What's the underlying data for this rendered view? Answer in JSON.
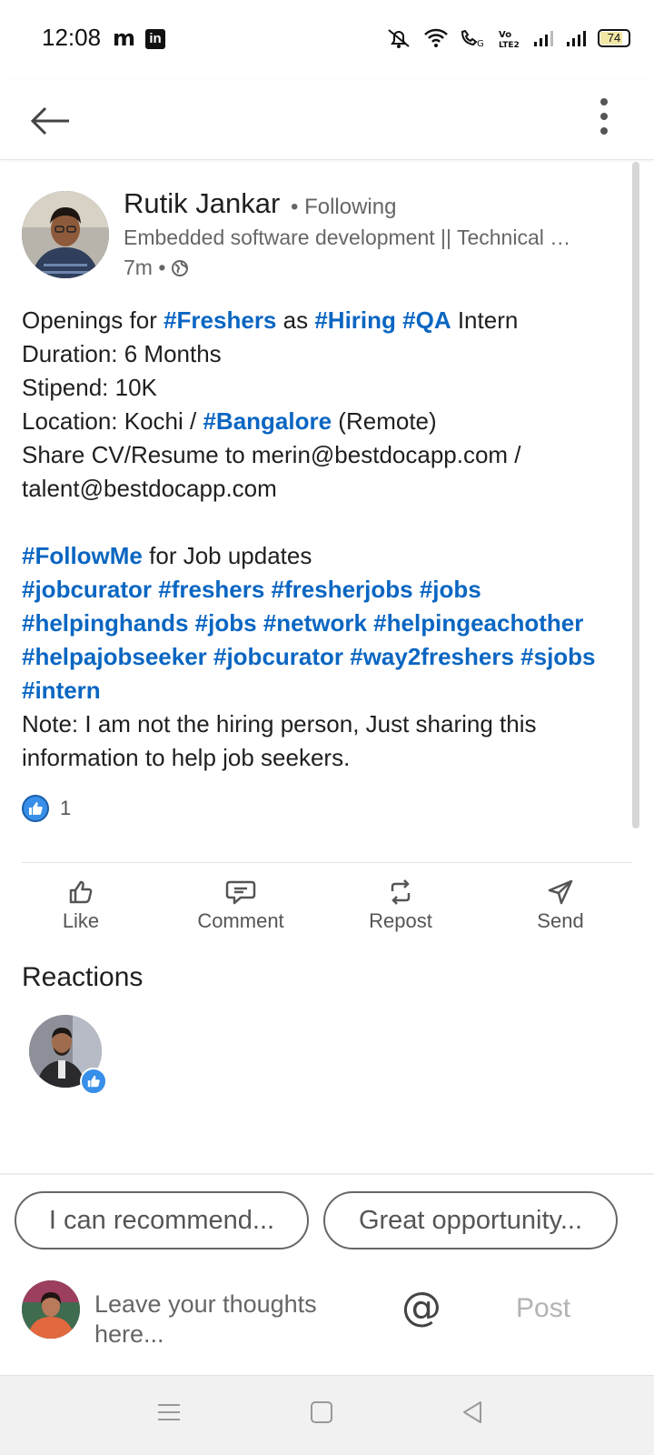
{
  "status_bar": {
    "time": "12:08",
    "app_icons": [
      "m",
      "in"
    ],
    "battery": "74"
  },
  "post": {
    "author": {
      "name": "Rutik Jankar",
      "follow_status": "• Following",
      "headline": "Embedded software development || Technical …",
      "time_ago": "7m •",
      "visibility_icon": "globe-icon"
    },
    "body": {
      "line1": {
        "t1": "Openings for ",
        "tag1": "#Freshers",
        "t2": " as ",
        "tag2": "#Hiring",
        "t3": " ",
        "tag3": "#QA",
        "t4": " Intern"
      },
      "line2": "Duration: 6 Months",
      "line3": "Stipend: 10K",
      "line4": {
        "t1": "Location: Kochi / ",
        "tag1": "#Bangalore",
        "t2": " (Remote)"
      },
      "line5": "Share CV/Resume to merin@bestdocapp.com /",
      "line6": "talent@bestdocapp.com",
      "line7": {
        "tag1": "#FollowMe",
        "t1": " for Job updates"
      },
      "line8": "#jobcurator #freshers #fresherjobs #jobs",
      "line9": "#helpinghands #jobs #network #helpingeachother",
      "line10": "#helpajobseeker #jobcurator #way2freshers #sjobs",
      "line11": "#intern",
      "line12": "Note: I am not the hiring person, Just sharing this",
      "line13": "information to help job seekers."
    },
    "reaction_count": "1",
    "actions": [
      {
        "label": "Like",
        "icon": "thumbs-up-icon"
      },
      {
        "label": "Comment",
        "icon": "comment-icon"
      },
      {
        "label": "Repost",
        "icon": "repost-icon"
      },
      {
        "label": "Send",
        "icon": "send-icon"
      }
    ]
  },
  "reactions": {
    "title": "Reactions"
  },
  "composer": {
    "suggestions": [
      "I can recommend...",
      "Great opportunity..."
    ],
    "placeholder": "Leave your thoughts here...",
    "mention_symbol": "@",
    "post_label": "Post"
  },
  "colors": {
    "link": "#0a66c2",
    "like_badge": "#378fe9",
    "text_secondary": "#666666"
  }
}
